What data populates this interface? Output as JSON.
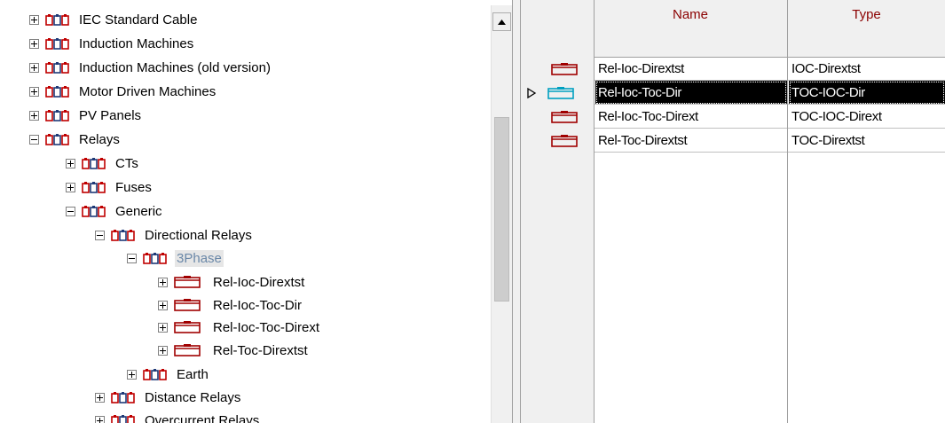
{
  "tree": {
    "items": [
      {
        "id": "iec-cable",
        "label": "IEC Standard Cable",
        "state": "collapsed",
        "icon": "folder-library-icon"
      },
      {
        "id": "induction",
        "label": "Induction Machines",
        "state": "collapsed",
        "icon": "folder-library-icon"
      },
      {
        "id": "induction-old",
        "label": "Induction Machines (old version)",
        "state": "collapsed",
        "icon": "folder-library-icon"
      },
      {
        "id": "motor-driven",
        "label": "Motor Driven Machines",
        "state": "collapsed",
        "icon": "folder-library-icon"
      },
      {
        "id": "pv-panels",
        "label": "PV Panels",
        "state": "collapsed",
        "icon": "folder-library-icon"
      },
      {
        "id": "relays",
        "label": "Relays",
        "state": "expanded",
        "icon": "folder-library-icon"
      },
      {
        "id": "cts",
        "label": "CTs",
        "state": "collapsed",
        "icon": "folder-library-icon"
      },
      {
        "id": "fuses",
        "label": "Fuses",
        "state": "collapsed",
        "icon": "folder-library-icon"
      },
      {
        "id": "generic",
        "label": "Generic",
        "state": "expanded",
        "icon": "folder-library-icon"
      },
      {
        "id": "directional",
        "label": "Directional Relays",
        "state": "expanded",
        "icon": "folder-library-icon"
      },
      {
        "id": "3phase",
        "label": "3Phase",
        "state": "expanded",
        "icon": "folder-library-icon",
        "selected": true
      },
      {
        "id": "rel-ioc-dirextst",
        "label": "Rel-Ioc-Dirextst",
        "state": "collapsed",
        "icon": "relay-type-icon"
      },
      {
        "id": "rel-ioc-toc-dir",
        "label": "Rel-Ioc-Toc-Dir",
        "state": "collapsed",
        "icon": "relay-type-icon"
      },
      {
        "id": "rel-ioc-toc-dirext",
        "label": "Rel-Ioc-Toc-Dirext",
        "state": "collapsed",
        "icon": "relay-type-icon"
      },
      {
        "id": "rel-toc-dirextst",
        "label": "Rel-Toc-Dirextst",
        "state": "collapsed",
        "icon": "relay-type-icon"
      },
      {
        "id": "earth",
        "label": "Earth",
        "state": "collapsed",
        "icon": "folder-library-icon"
      },
      {
        "id": "distance",
        "label": "Distance Relays",
        "state": "collapsed",
        "icon": "folder-library-icon"
      },
      {
        "id": "overcurrent",
        "label": "Overcurrent Relays",
        "state": "collapsed",
        "icon": "folder-library-icon"
      }
    ]
  },
  "grid": {
    "columns": [
      "Name",
      "Type"
    ],
    "rows": [
      {
        "name": "Rel-Ioc-Dirextst",
        "type": "IOC-Dirextst",
        "selected": false
      },
      {
        "name": "Rel-Ioc-Toc-Dir",
        "type": "TOC-IOC-Dir",
        "selected": true
      },
      {
        "name": "Rel-Ioc-Toc-Dirext",
        "type": "TOC-IOC-Dirext",
        "selected": false
      },
      {
        "name": "Rel-Toc-Dirextst",
        "type": "TOC-Dirextst",
        "selected": false
      }
    ]
  },
  "colors": {
    "folder_icon_red": "#c00000",
    "folder_icon_navy": "#1f3a78",
    "relay_icon_red": "#a00000",
    "relay_icon_selected": "#00a0c0",
    "header_text": "#8b0000",
    "selected_label": "#6b88a8"
  }
}
